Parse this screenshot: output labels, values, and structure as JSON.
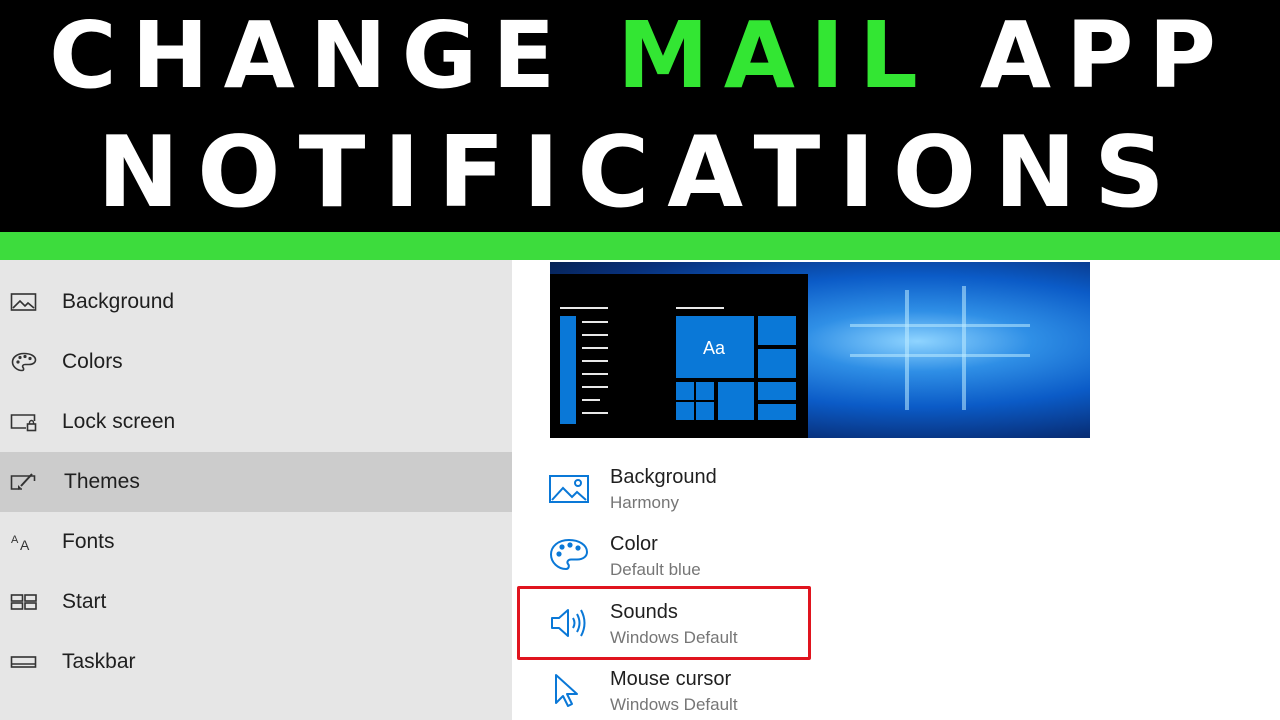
{
  "banner": {
    "line1_part1": "CHANGE ",
    "line1_highlight": "MAIL",
    "line1_part2": " APP",
    "line2": "NOTIFICATIONS",
    "text_color": "#ffffff",
    "highlight_color": "#33e633",
    "bar_color": "#3ddc3d"
  },
  "sidebar": {
    "items": [
      {
        "label": "Background",
        "icon": "image-icon",
        "selected": false
      },
      {
        "label": "Colors",
        "icon": "palette-icon",
        "selected": false
      },
      {
        "label": "Lock screen",
        "icon": "lock-screen-icon",
        "selected": false
      },
      {
        "label": "Themes",
        "icon": "themes-brush-icon",
        "selected": true
      },
      {
        "label": "Fonts",
        "icon": "fonts-icon",
        "selected": false
      },
      {
        "label": "Start",
        "icon": "start-tiles-icon",
        "selected": false
      },
      {
        "label": "Taskbar",
        "icon": "taskbar-icon",
        "selected": false
      }
    ]
  },
  "theme_preview": {
    "tile_label": "Aa",
    "accent_color": "#0a78d7"
  },
  "theme_properties": [
    {
      "title": "Background",
      "value": "Harmony",
      "icon": "image-icon"
    },
    {
      "title": "Color",
      "value": "Default blue",
      "icon": "palette-icon"
    },
    {
      "title": "Sounds",
      "value": "Windows Default",
      "icon": "speaker-icon",
      "highlighted": true
    },
    {
      "title": "Mouse cursor",
      "value": "Windows Default",
      "icon": "cursor-icon"
    }
  ],
  "colors": {
    "icon_blue": "#0a78d7",
    "highlight_border": "#e0141e"
  }
}
